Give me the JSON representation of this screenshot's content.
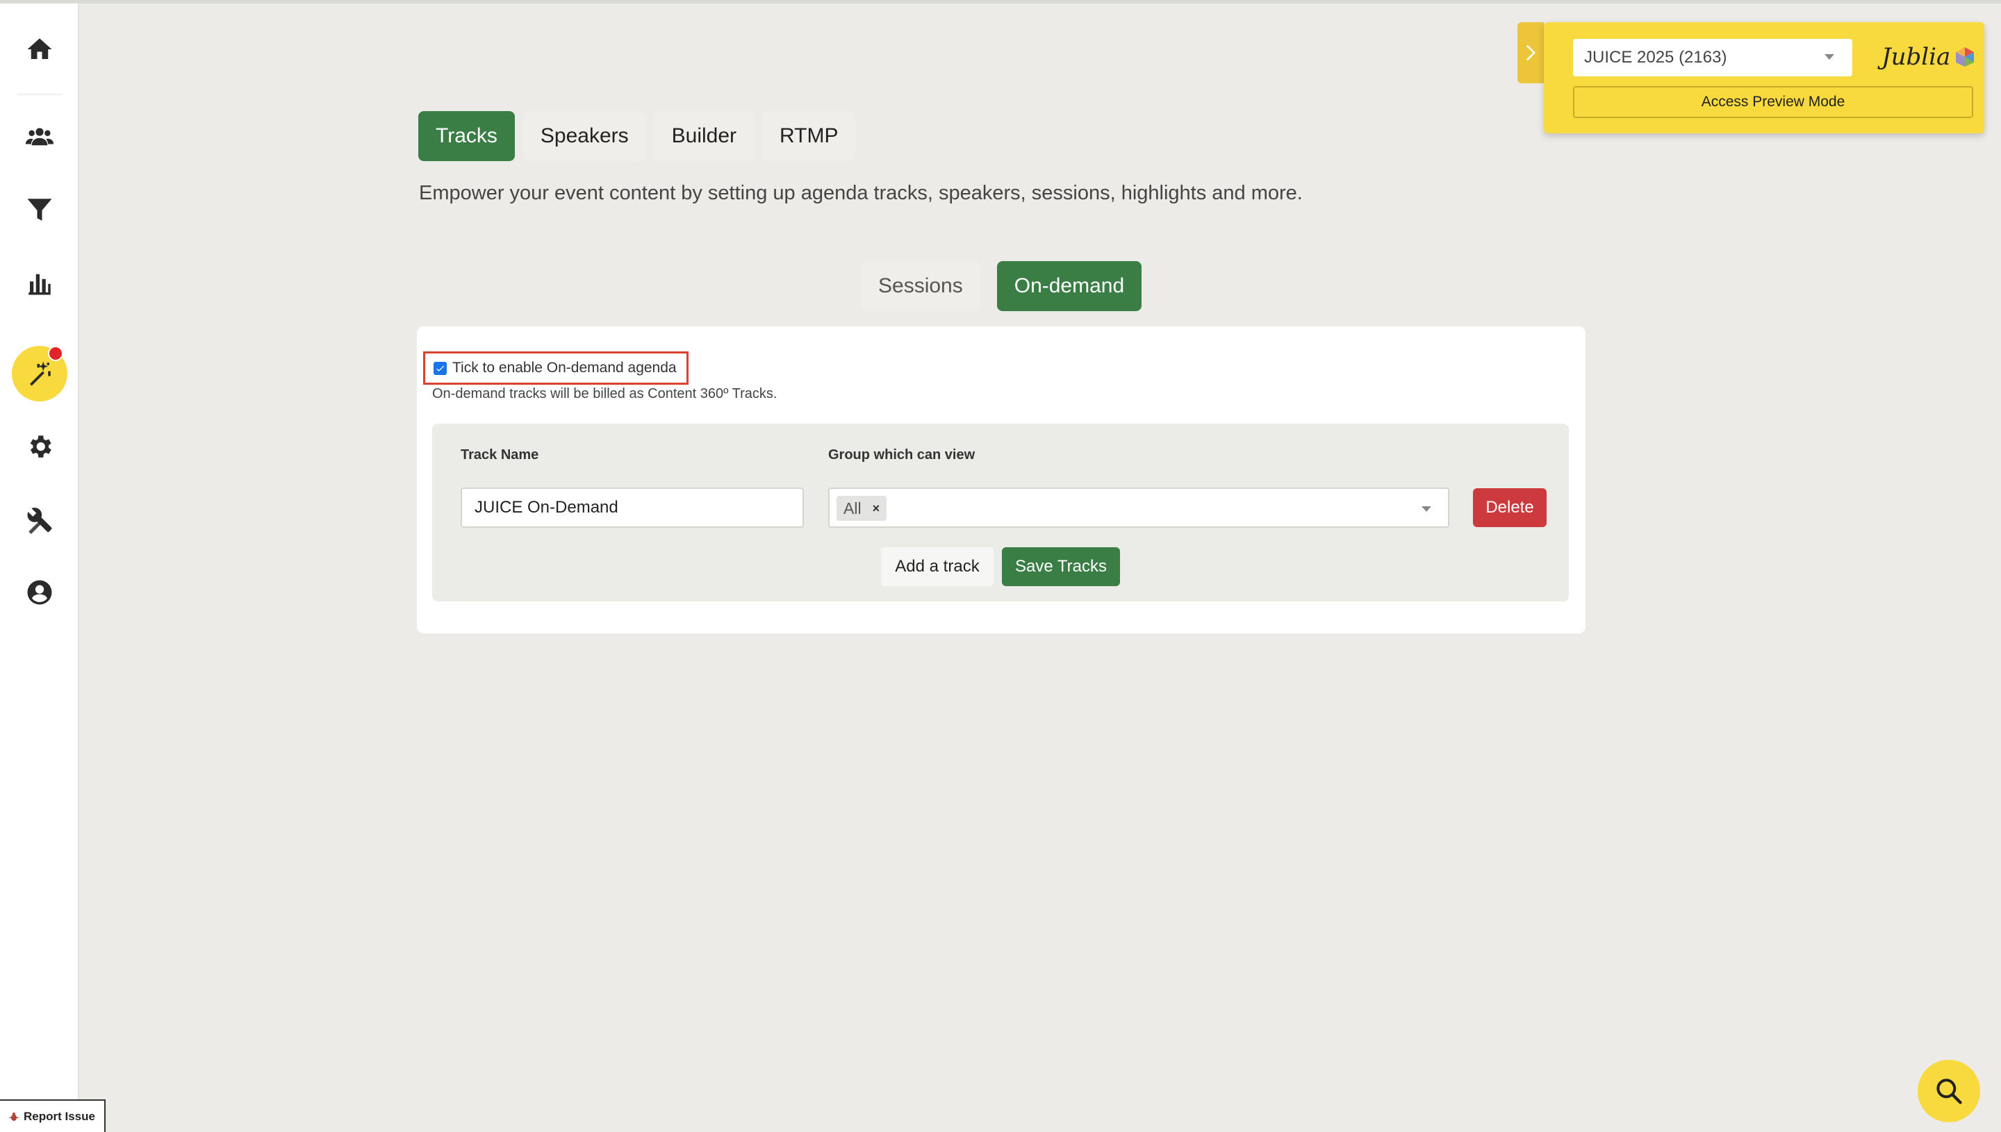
{
  "sidebar": {
    "items": [
      {
        "icon": "home-icon"
      },
      {
        "icon": "users-icon"
      },
      {
        "icon": "filter-icon"
      },
      {
        "icon": "bar-chart-icon"
      },
      {
        "icon": "magic-wand-icon",
        "active": true,
        "has_notification": true
      },
      {
        "icon": "gear-icon"
      },
      {
        "icon": "tools-icon"
      },
      {
        "icon": "user-circle-icon"
      }
    ],
    "active_color": "#f8da3f"
  },
  "report_issue": {
    "label": "Report Issue",
    "icon": "bug-icon"
  },
  "main_tabs": [
    {
      "label": "Tracks",
      "active": true
    },
    {
      "label": "Speakers"
    },
    {
      "label": "Builder"
    },
    {
      "label": "RTMP"
    }
  ],
  "subtitle": "Empower your event content by setting up agenda tracks, speakers, sessions, highlights and more.",
  "sub_tabs": [
    {
      "label": "Sessions"
    },
    {
      "label": "On-demand",
      "active": true
    }
  ],
  "on_demand": {
    "enable_label": "Tick to enable On-demand agenda",
    "enabled": true,
    "note": "On-demand tracks will be billed as Content 360º Tracks.",
    "columns": {
      "track_name": "Track Name",
      "group": "Group which can view"
    },
    "track": {
      "name": "JUICE On-Demand",
      "groups": [
        "All"
      ]
    },
    "chip_remove": "×",
    "delete_label": "Delete",
    "add_label": "Add a track",
    "save_label": "Save Tracks"
  },
  "event_widget": {
    "selected_event": "JUICE 2025 (2163)",
    "logo_text": "Jublia",
    "preview_label": "Access Preview Mode"
  },
  "colors": {
    "primary_green": "#3a7d45",
    "danger_red": "#cc3a3d",
    "brand_yellow": "#f8da3f",
    "highlight_border": "#d9432f"
  }
}
